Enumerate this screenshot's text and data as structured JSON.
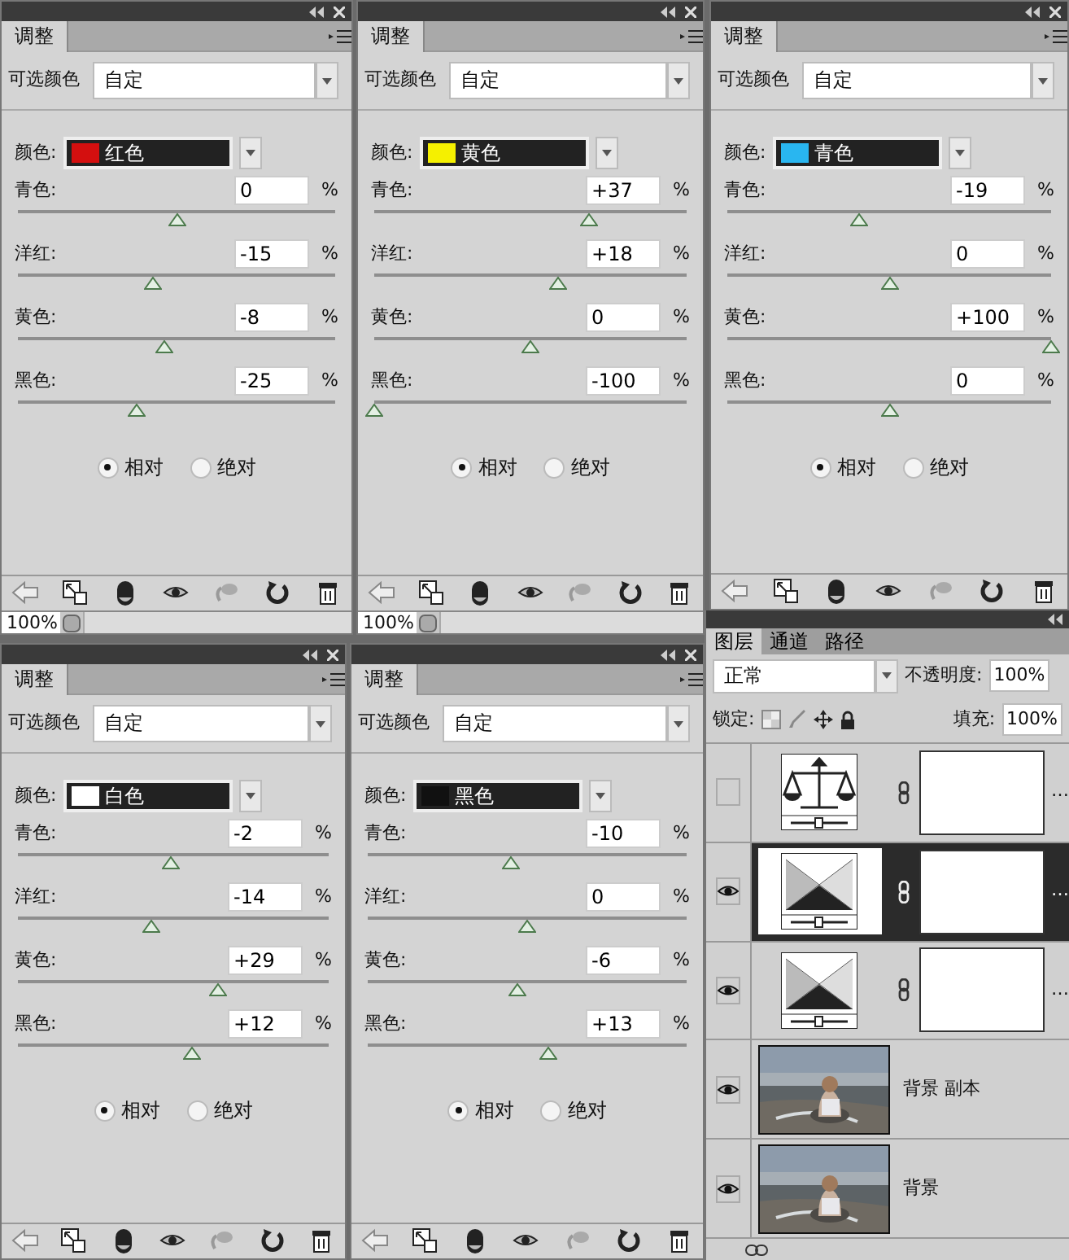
{
  "adjustment_panels": [
    {
      "tab": "调整",
      "preset_label": "可选颜色",
      "preset": "自定",
      "color_label": "颜色:",
      "color_name": "红色",
      "color": "#d40f0f",
      "sliders": [
        {
          "label": "青色:",
          "value": "0",
          "level": 0.5,
          "unit": "%"
        },
        {
          "label": "洋红:",
          "value": "-15",
          "level": 0.425,
          "unit": "%"
        },
        {
          "label": "黄色:",
          "value": "-8",
          "level": 0.46,
          "unit": "%"
        },
        {
          "label": "黑色:",
          "value": "-25",
          "level": 0.375,
          "unit": "%"
        }
      ],
      "radios": [
        {
          "label": "相对",
          "selected": true
        },
        {
          "label": "绝对",
          "selected": false
        }
      ],
      "zoom": "100%"
    },
    {
      "tab": "调整",
      "preset_label": "可选颜色",
      "preset": "自定",
      "color_label": "颜色:",
      "color_name": "黄色",
      "color": "#f5f000",
      "sliders": [
        {
          "label": "青色:",
          "value": "+37",
          "level": 0.685,
          "unit": "%"
        },
        {
          "label": "洋红:",
          "value": "+18",
          "level": 0.59,
          "unit": "%"
        },
        {
          "label": "黄色:",
          "value": "0",
          "level": 0.5,
          "unit": "%"
        },
        {
          "label": "黑色:",
          "value": "-100",
          "level": 0,
          "unit": "%"
        }
      ],
      "radios": [
        {
          "label": "相对",
          "selected": true
        },
        {
          "label": "绝对",
          "selected": false
        }
      ],
      "zoom": "100%"
    },
    {
      "tab": "调整",
      "preset_label": "可选颜色",
      "preset": "自定",
      "color_label": "颜色:",
      "color_name": "青色",
      "color": "#29b6f0",
      "sliders": [
        {
          "label": "青色:",
          "value": "-19",
          "level": 0.405,
          "unit": "%"
        },
        {
          "label": "洋红:",
          "value": "0",
          "level": 0.5,
          "unit": "%"
        },
        {
          "label": "黄色:",
          "value": "+100",
          "level": 1,
          "unit": "%"
        },
        {
          "label": "黑色:",
          "value": "0",
          "level": 0.5,
          "unit": "%"
        }
      ],
      "radios": [
        {
          "label": "相对",
          "selected": true
        },
        {
          "label": "绝对",
          "selected": false
        }
      ]
    },
    {
      "tab": "调整",
      "preset_label": "可选颜色",
      "preset": "自定",
      "color_label": "颜色:",
      "color_name": "白色",
      "color": "#ffffff",
      "sliders": [
        {
          "label": "青色:",
          "value": "-2",
          "level": 0.49,
          "unit": "%"
        },
        {
          "label": "洋红:",
          "value": "-14",
          "level": 0.43,
          "unit": "%"
        },
        {
          "label": "黄色:",
          "value": "+29",
          "level": 0.645,
          "unit": "%"
        },
        {
          "label": "黑色:",
          "value": "+12",
          "level": 0.56,
          "unit": "%"
        }
      ],
      "radios": [
        {
          "label": "相对",
          "selected": true
        },
        {
          "label": "绝对",
          "selected": false
        }
      ]
    },
    {
      "tab": "调整",
      "preset_label": "可选颜色",
      "preset": "自定",
      "color_label": "颜色:",
      "color_name": "黑色",
      "color": "#111111",
      "sliders": [
        {
          "label": "青色:",
          "value": "-10",
          "level": 0.45,
          "unit": "%"
        },
        {
          "label": "洋红:",
          "value": "0",
          "level": 0.5,
          "unit": "%"
        },
        {
          "label": "黄色:",
          "value": "-6",
          "level": 0.47,
          "unit": "%"
        },
        {
          "label": "黑色:",
          "value": "+13",
          "level": 0.565,
          "unit": "%"
        }
      ],
      "radios": [
        {
          "label": "相对",
          "selected": true
        },
        {
          "label": "绝对",
          "selected": false
        }
      ]
    }
  ],
  "layers_panel": {
    "tabs": [
      {
        "label": "图层",
        "selected": true
      },
      {
        "label": "通道",
        "selected": false
      },
      {
        "label": "路径",
        "selected": false
      }
    ],
    "blend_mode": "正常",
    "opacity_label": "不透明度:",
    "opacity": "100%",
    "lock_label": "锁定:",
    "fill_label": "填充:",
    "fill": "100%",
    "layers": [
      {
        "kind": "color_balance",
        "name": "…",
        "visible": false,
        "selected": false
      },
      {
        "kind": "selective_color",
        "name": "…",
        "visible": true,
        "selected": true
      },
      {
        "kind": "selective_color",
        "name": "…",
        "visible": true,
        "selected": false
      },
      {
        "name": "背景 副本",
        "visible": true,
        "selected": false
      },
      {
        "name": "背景",
        "visible": true,
        "selected": false
      }
    ]
  }
}
